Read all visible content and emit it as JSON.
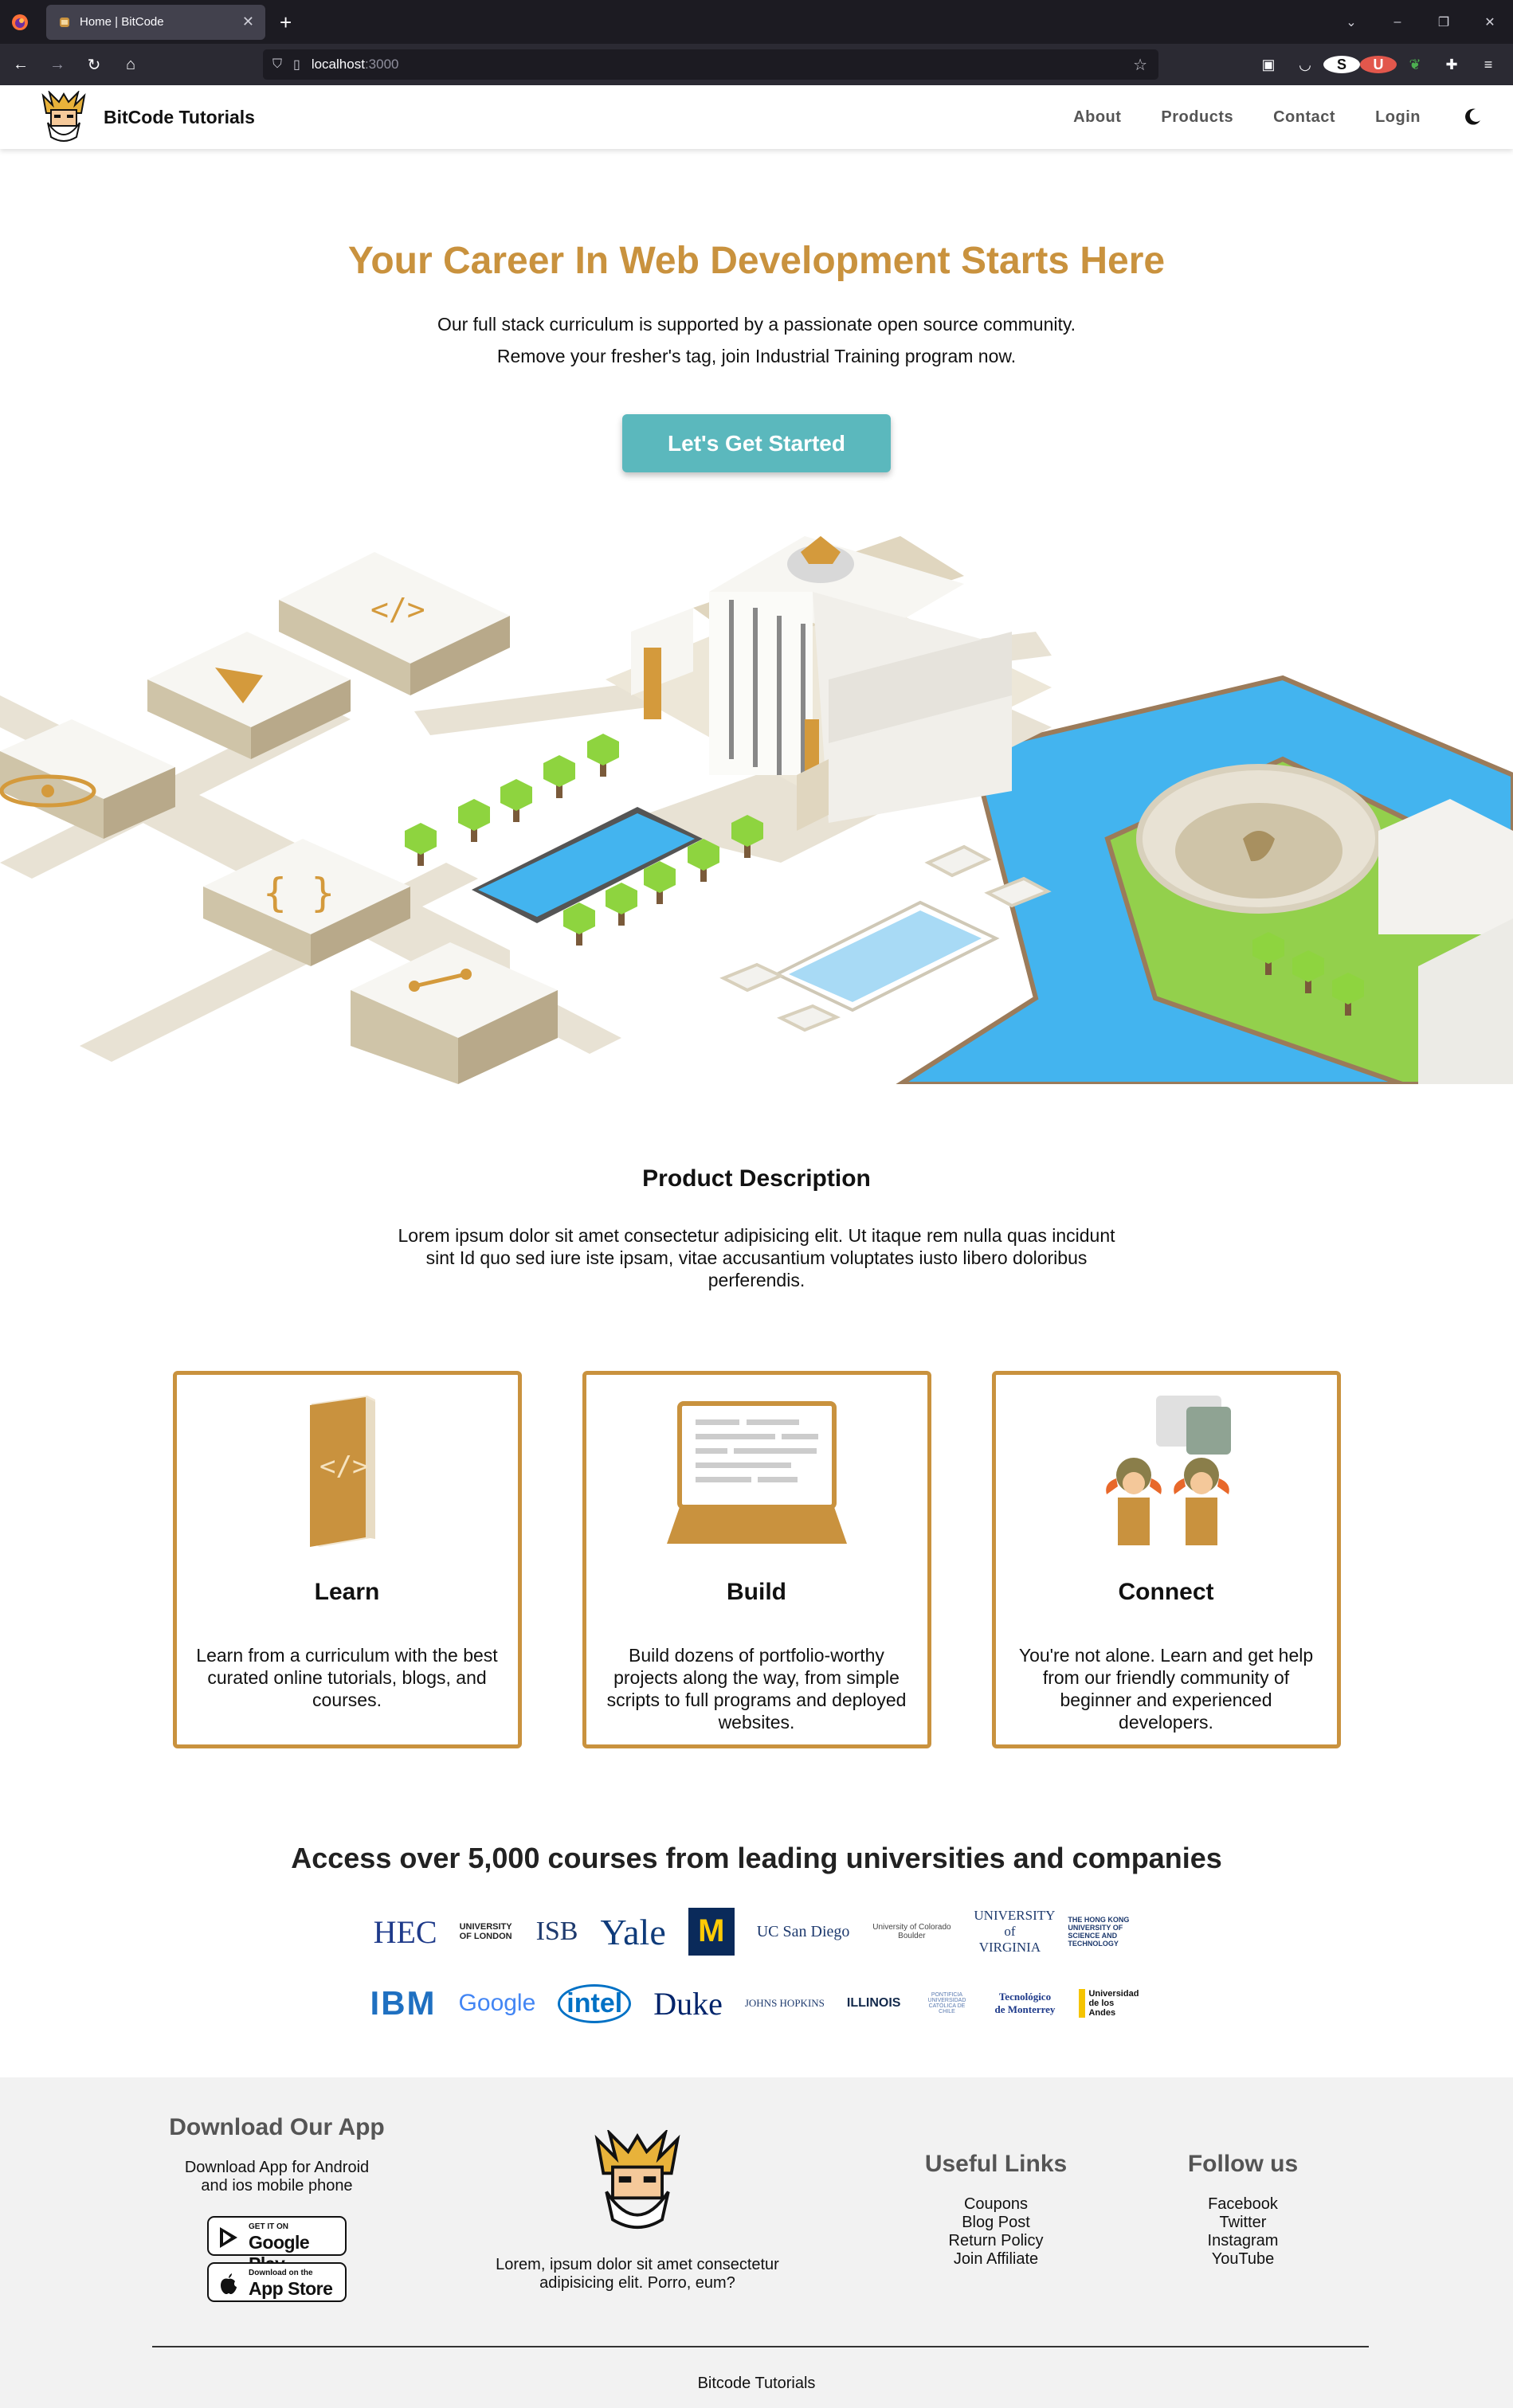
{
  "browser": {
    "tab_title": "Home | BitCode",
    "url_host": "localhost",
    "url_port": ":3000"
  },
  "header": {
    "brand": "BitCode Tutorials",
    "menu": [
      "About",
      "Products",
      "Contact",
      "Login"
    ]
  },
  "hero": {
    "title": "Your Career In Web Development Starts Here",
    "line1": "Our full stack curriculum is supported by a passionate open source community.",
    "line2": "Remove your fresher's tag, join Industrial Training program now.",
    "cta": "Let's Get Started"
  },
  "product": {
    "title": "Product Description",
    "text": "Lorem ipsum dolor sit amet consectetur adipisicing elit. Ut itaque rem nulla quas incidunt sint Id quo sed iure iste ipsam, vitae accusantium voluptates iusto libero doloribus perferendis."
  },
  "cards": [
    {
      "title": "Learn",
      "text": "Learn from a curriculum with the best curated online tutorials, blogs, and courses."
    },
    {
      "title": "Build",
      "text": "Build dozens of portfolio-worthy projects along the way, from simple scripts to full programs and deployed websites."
    },
    {
      "title": "Connect",
      "text": "You're not alone. Learn and get help from our friendly community of beginner and experienced developers."
    }
  ],
  "partners": {
    "title": "Access over 5,000 courses from leading universities and companies",
    "row1": [
      "HEC",
      "UNIVERSITY OF LONDON",
      "ISB",
      "Yale",
      "M",
      "UC San Diego",
      "University of Colorado Boulder",
      "UNIVERSITY of VIRGINIA",
      "THE HONG KONG UNIVERSITY OF SCIENCE AND TECHNOLOGY"
    ],
    "row2": [
      "IBM",
      "Google",
      "intel",
      "Duke",
      "JOHNS HOPKINS",
      "ILLINOIS",
      "PONTIFICIA UNIVERSIDAD CATÓLICA DE CHILE",
      "Tecnológico de Monterrey",
      "Universidad de los Andes"
    ]
  },
  "footer": {
    "app_title": "Download Our App",
    "app_text_1": "Download App for Android",
    "app_text_2": "and ios mobile phone",
    "google_top": "GET IT ON",
    "google_main": "Google Play",
    "apple_top": "Download on the",
    "apple_main": "App Store",
    "about_1": "Lorem, ipsum dolor sit amet consectetur",
    "about_2": "adipisicing elit. Porro, eum?",
    "links_title": "Useful Links",
    "links": [
      "Coupons",
      "Blog Post",
      "Return Policy",
      "Join Affiliate"
    ],
    "follow_title": "Follow us",
    "follow": [
      "Facebook",
      "Twitter",
      "Instagram",
      "YouTube"
    ],
    "copyright": "Bitcode Tutorials"
  },
  "colors": {
    "accent": "#c9923e",
    "cta": "#5bb8bd",
    "water": "#43b4ef",
    "grass": "#93d04c"
  }
}
